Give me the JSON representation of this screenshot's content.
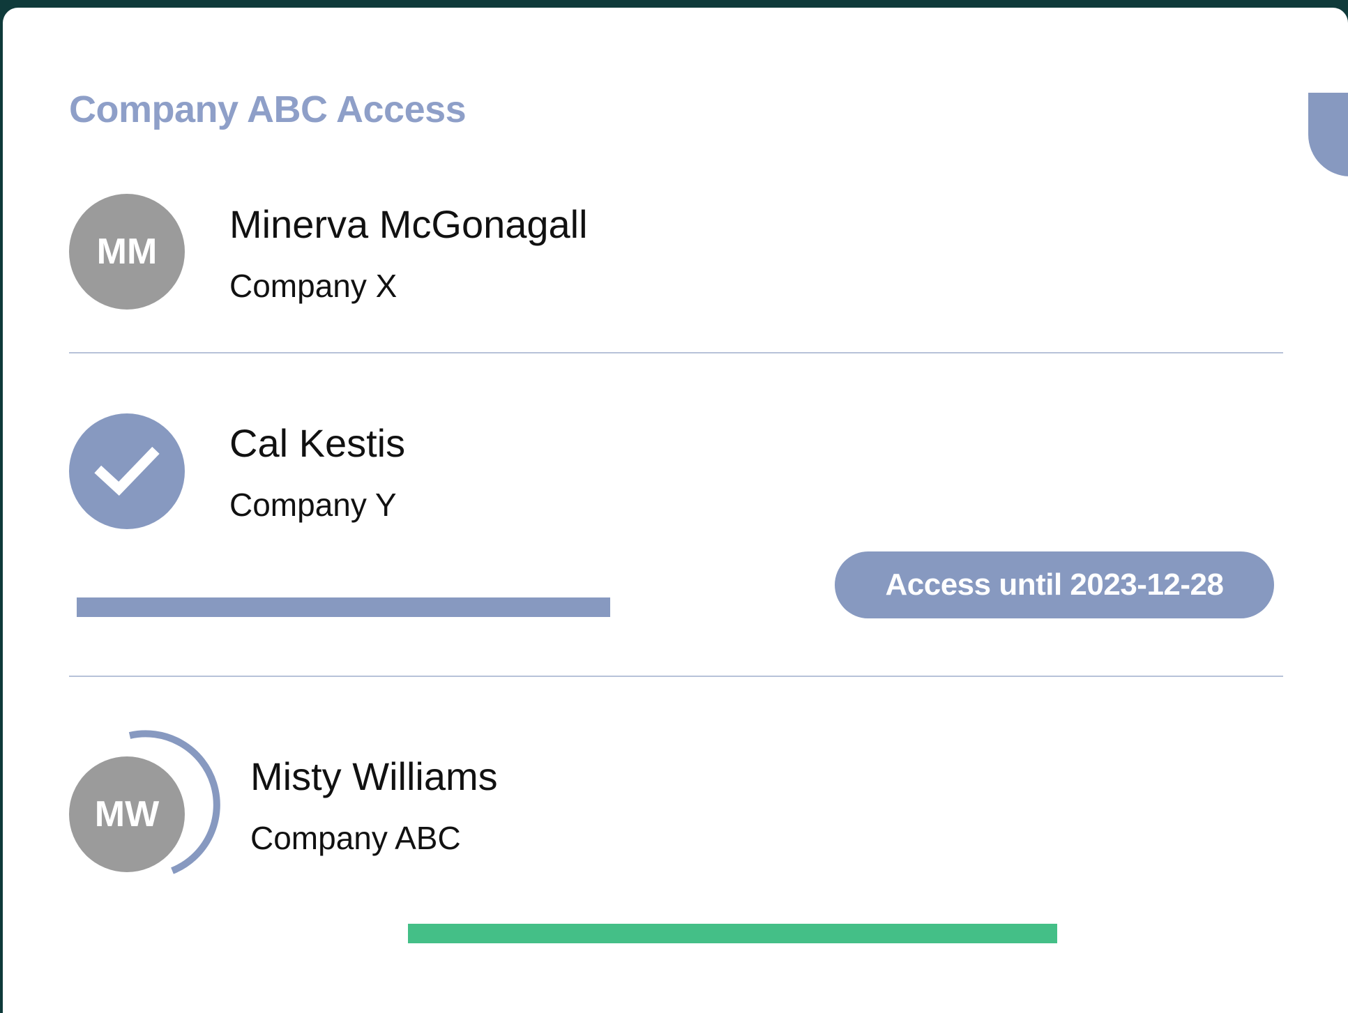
{
  "panel": {
    "title": "Company ABC Access"
  },
  "users": [
    {
      "name": "Minerva McGonagall",
      "company": "Company X",
      "avatar_initials": "MM",
      "avatar_color": "#9b9b9b"
    },
    {
      "name": "Cal Kestis",
      "company": "Company Y",
      "avatar_icon": "check-icon",
      "avatar_color": "#8799c0",
      "access_badge": "Access until 2023-12-28",
      "bar_color": "#8799c0"
    },
    {
      "name": "Misty Williams",
      "company": "Company ABC",
      "avatar_initials": "MW",
      "avatar_color": "#9b9b9b",
      "ring_progress": 0.35,
      "bar_color": "#44bf87"
    }
  ],
  "colors": {
    "accent": "#8799c0",
    "title": "#8e9fc8",
    "success": "#44bf87",
    "divider": "#b7c2d8",
    "background": "#0f3a3a"
  }
}
